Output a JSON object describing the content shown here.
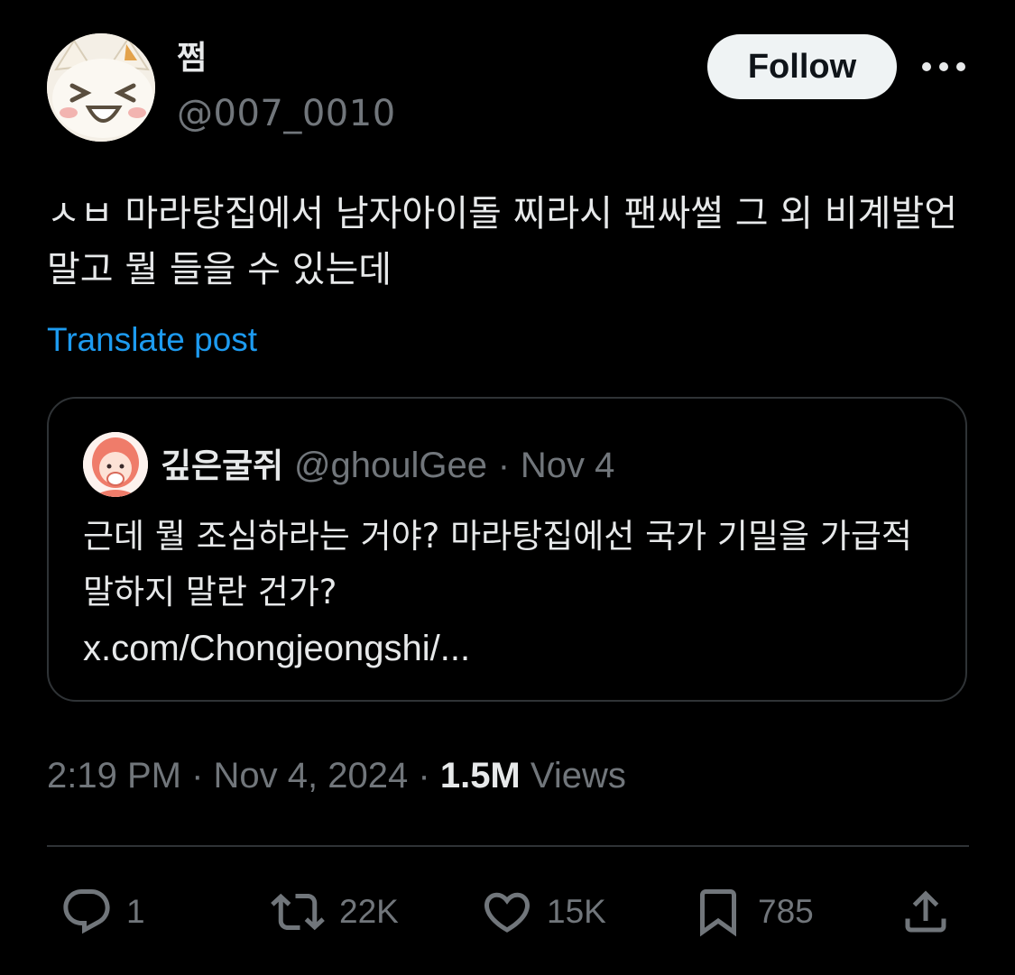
{
  "author": {
    "display_name": "쩜",
    "handle": "@007_0010"
  },
  "follow_label": "Follow",
  "post_text": "ㅅㅂ 마라탕집에서 남자아이돌 찌라시 팬싸썰 그 외 비계발언 말고 뭘 들을 수 있는데",
  "translate_label": "Translate post",
  "quoted": {
    "display_name": "깊은굴쥐",
    "handle": "@ghoulGee",
    "separator": "·",
    "date": "Nov 4",
    "text": "근데 뭘 조심하라는 거야? 마라탕집에선 국가 기밀을 가급적 말하지 말란 건가?",
    "link": "x.com/Chongjeongshi/..."
  },
  "timestamp": {
    "time": "2:19 PM",
    "separator": "·",
    "date": "Nov 4, 2024",
    "views_count": "1.5M",
    "views_label": "Views"
  },
  "actions": {
    "replies": "1",
    "reposts": "22K",
    "likes": "15K",
    "bookmarks": "785"
  },
  "colors": {
    "background": "#000000",
    "text": "#e7e9ea",
    "muted": "#71767b",
    "link": "#1d9bf0",
    "border": "#2f3336"
  },
  "icons": [
    "more-icon",
    "reply-icon",
    "repost-icon",
    "like-icon",
    "bookmark-icon",
    "share-icon"
  ]
}
